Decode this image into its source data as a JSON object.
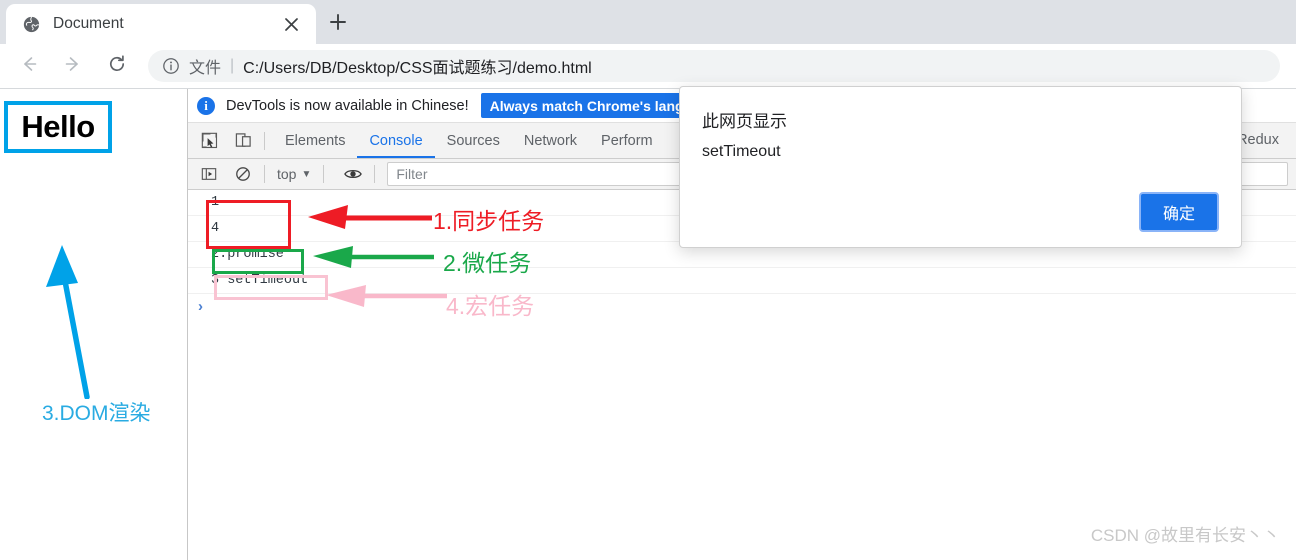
{
  "browser": {
    "tab": {
      "title": "Document",
      "favicon_icon": "globe-icon",
      "close_icon": "close-icon"
    },
    "new_tab_icon": "plus-icon",
    "nav": {
      "back_icon": "arrow-left-icon",
      "forward_icon": "arrow-right-icon",
      "reload_icon": "reload-icon"
    },
    "omnibox": {
      "info_icon": "info-circle-icon",
      "file_label": "文件",
      "separator": "|",
      "url": "C:/Users/DB/Desktop/CSS面试题练习/demo.html"
    }
  },
  "page": {
    "hello_text": "Hello",
    "annotation_dom": "3.DOM渲染",
    "box_color": "#00a2e8",
    "arrow_color": "#29abe2"
  },
  "devtools": {
    "banner": {
      "icon": "info-circle-icon",
      "icon_glyph": "i",
      "text": "DevTools is now available in Chinese!",
      "button_label": "Always match Chrome's langu"
    },
    "toolbar_icons": {
      "inspect": "inspect-element-icon",
      "device": "device-toolbar-icon"
    },
    "tabs": [
      {
        "label": "Elements",
        "active": false
      },
      {
        "label": "Console",
        "active": true
      },
      {
        "label": "Sources",
        "active": false
      },
      {
        "label": "Network",
        "active": false
      },
      {
        "label": "Perform",
        "active": false
      }
    ],
    "tab_right": {
      "label": "Redux"
    },
    "console_toolbar": {
      "sidebar_icon": "console-sidebar-icon",
      "clear_icon": "clear-console-icon",
      "context_label": "top",
      "context_caret": "▼",
      "eye_icon": "eye-icon",
      "filter_placeholder": "Filter"
    },
    "console_messages": [
      {
        "text": "1"
      },
      {
        "text": "4"
      },
      {
        "text": "2.promise"
      },
      {
        "text": "3 setTimeout"
      }
    ],
    "prompt_caret": "›"
  },
  "annotations": [
    {
      "label": "1.同步任务",
      "color": "#ee1c25"
    },
    {
      "label": "2.微任务",
      "color": "#1aa84a"
    },
    {
      "label": "4.宏任务",
      "color": "#f9b8ca"
    }
  ],
  "dialog": {
    "title": "此网页显示",
    "message": "setTimeout",
    "ok_label": "确定"
  },
  "watermark": "CSDN @故里有长安丶丶"
}
